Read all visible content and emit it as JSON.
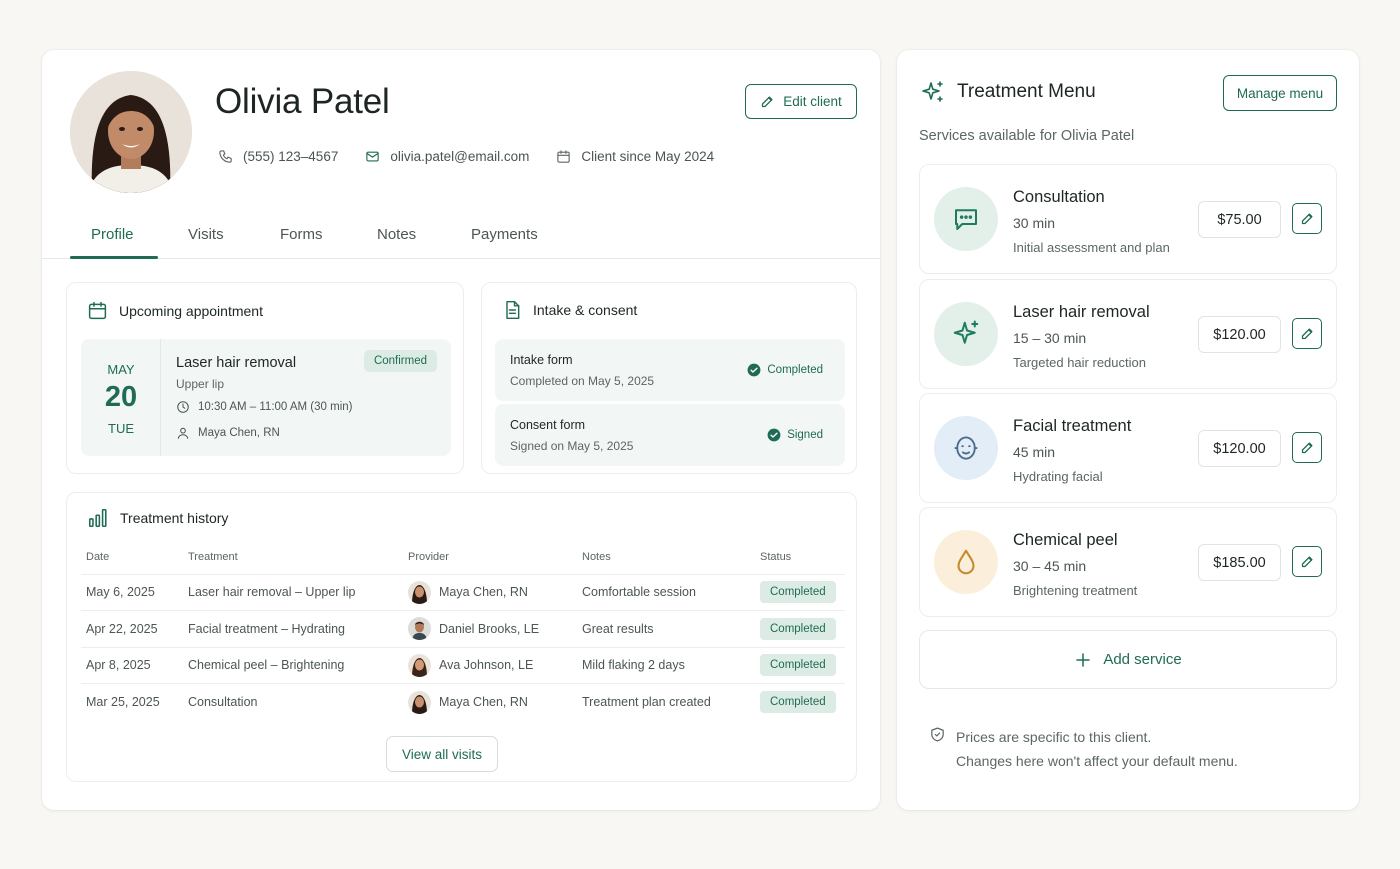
{
  "client": {
    "name": "Olivia Patel",
    "phone": "(555) 123–4567",
    "email": "olivia.patel@email.com",
    "since": "Client since May 2024",
    "edit_label": "Edit client"
  },
  "tabs": [
    {
      "label": "Profile",
      "active": true
    },
    {
      "label": "Visits"
    },
    {
      "label": "Forms"
    },
    {
      "label": "Notes"
    },
    {
      "label": "Payments"
    }
  ],
  "appointment": {
    "heading": "Upcoming appointment",
    "month": "MAY",
    "day": "20",
    "weekday": "TUE",
    "title": "Laser hair removal",
    "area": "Upper lip",
    "time": "10:30 AM – 11:00 AM (30 min)",
    "provider": "Maya Chen, RN",
    "status": "Confirmed"
  },
  "intake": {
    "heading": "Intake & consent",
    "items": [
      {
        "title": "Intake form",
        "sub": "Completed on May 5, 2025",
        "status": "Completed"
      },
      {
        "title": "Consent form",
        "sub": "Signed on May 5, 2025",
        "status": "Signed"
      }
    ]
  },
  "history": {
    "heading": "Treatment history",
    "columns": [
      "Date",
      "Treatment",
      "Provider",
      "Notes",
      "Status"
    ],
    "rows": [
      {
        "date": "May 6, 2025",
        "treatment": "Laser hair removal – Upper lip",
        "provider": "Maya Chen, RN",
        "notes": "Comfortable session",
        "status": "Completed"
      },
      {
        "date": "Apr 22, 2025",
        "treatment": "Facial treatment – Hydrating",
        "provider": "Daniel Brooks, LE",
        "notes": "Great results",
        "status": "Completed"
      },
      {
        "date": "Apr 8, 2025",
        "treatment": "Chemical peel – Brightening",
        "provider": "Ava Johnson, LE",
        "notes": "Mild flaking 2 days",
        "status": "Completed"
      },
      {
        "date": "Mar 25, 2025",
        "treatment": "Consultation",
        "provider": "Maya Chen, RN",
        "notes": "Treatment plan created",
        "status": "Completed"
      }
    ],
    "view_all_label": "View all visits"
  },
  "menu": {
    "title": "Treatment Menu",
    "manage_label": "Manage menu",
    "subtitle": "Services available for Olivia Patel",
    "services": [
      {
        "name": "Consultation",
        "duration": "30 min",
        "description": "Initial assessment and plan",
        "price": "$75.00",
        "icon": "chat-bubble-icon"
      },
      {
        "name": "Laser hair removal",
        "duration": "15 – 30 min",
        "description": "Targeted hair reduction",
        "price": "$120.00",
        "icon": "sparkle-icon"
      },
      {
        "name": "Facial treatment",
        "duration": "45 min",
        "description": "Hydrating facial",
        "price": "$120.00",
        "icon": "face-icon"
      },
      {
        "name": "Chemical peel",
        "duration": "30 – 45 min",
        "description": "Brightening treatment",
        "price": "$185.00",
        "icon": "droplet-icon"
      }
    ],
    "add_label": "Add service",
    "note_line1": "Prices are specific to this client.",
    "note_line2": "Changes here won't affect your default menu."
  },
  "colors": {
    "accent": "#1f6b55",
    "badge_bg": "#dcece5",
    "panel_tint": "#f2f7f5",
    "page_bg": "#f8f7f4"
  }
}
